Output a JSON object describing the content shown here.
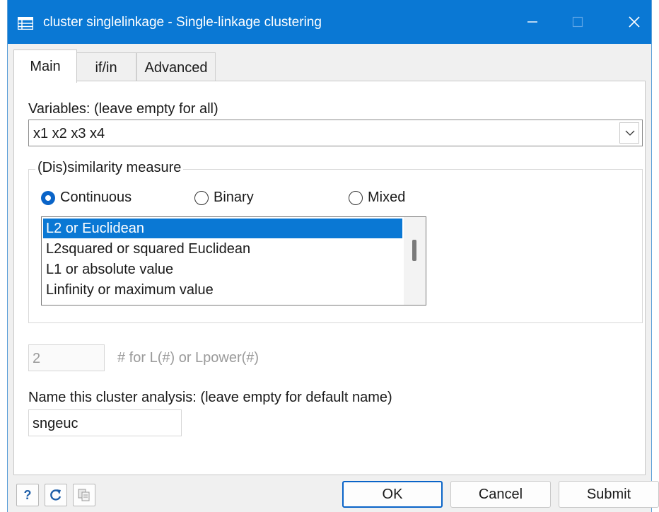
{
  "window": {
    "title": "cluster singlelinkage - Single-linkage clustering",
    "accent_color": "#0a78d4"
  },
  "tabs": [
    {
      "label": "Main",
      "active": true
    },
    {
      "label": "if/in",
      "active": false
    },
    {
      "label": "Advanced",
      "active": false
    }
  ],
  "variables": {
    "label": "Variables: (leave empty for all)",
    "value": "x1 x2 x3 x4"
  },
  "measure": {
    "legend": "(Dis)similarity measure",
    "radios": [
      {
        "label": "Continuous",
        "selected": true
      },
      {
        "label": "Binary",
        "selected": false
      },
      {
        "label": "Mixed",
        "selected": false
      }
    ],
    "list_items": [
      "L2 or Euclidean",
      "L2squared or squared Euclidean",
      "L1 or absolute value",
      "Linfinity or maximum value"
    ],
    "selected_item": "L2 or Euclidean"
  },
  "lpower": {
    "value": "2",
    "label": "# for L(#) or Lpower(#)"
  },
  "cluster_name": {
    "label": "Name this cluster analysis:  (leave empty for default name)",
    "value": "sngeuc"
  },
  "footer": {
    "icons": [
      "help-icon",
      "reset-icon",
      "copy-command-icon"
    ],
    "ok_label": "OK",
    "cancel_label": "Cancel",
    "submit_label": "Submit"
  }
}
